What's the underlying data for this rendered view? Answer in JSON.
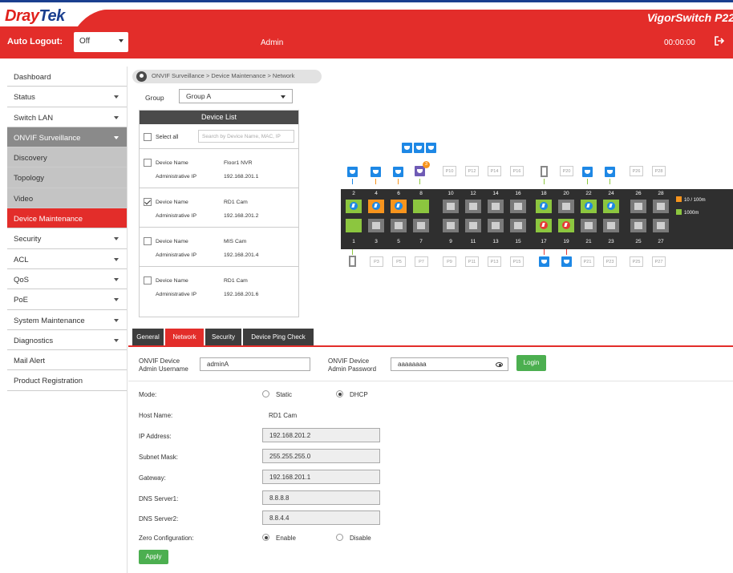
{
  "header": {
    "logo_a": "Dray",
    "logo_b": "Tek",
    "product": "VigorSwitch P22"
  },
  "toolbar": {
    "auto_logout_label": "Auto Logout:",
    "auto_logout_value": "Off",
    "user": "Admin",
    "timer": "00:00:00"
  },
  "sidebar": {
    "items": [
      {
        "label": "Dashboard"
      },
      {
        "label": "Status"
      },
      {
        "label": "Switch LAN"
      },
      {
        "label": "ONVIF Surveillance"
      },
      {
        "label": "Discovery"
      },
      {
        "label": "Topology"
      },
      {
        "label": "Video"
      },
      {
        "label": "Device Maintenance"
      },
      {
        "label": "Security"
      },
      {
        "label": "ACL"
      },
      {
        "label": "QoS"
      },
      {
        "label": "PoE"
      },
      {
        "label": "System Maintenance"
      },
      {
        "label": "Diagnostics"
      },
      {
        "label": "Mail Alert"
      },
      {
        "label": "Product Registration"
      }
    ]
  },
  "breadcrumb": "ONVIF Surveillance > Device Maintenance > Network",
  "group": {
    "label": "Group",
    "value": "Group A"
  },
  "device_list": {
    "title": "Device List",
    "select_all": "Select all",
    "search_placeholder": "Search by Device Name, MAC, IP",
    "name_label": "Device Name",
    "ip_label": "Administrative IP",
    "devices": [
      {
        "name": "Floor1 NVR",
        "ip": "192.168.201.1",
        "checked": false
      },
      {
        "name": "RD1 Cam",
        "ip": "192.168.201.2",
        "checked": true
      },
      {
        "name": "MIS Cam",
        "ip": "192.168.201.4",
        "checked": false
      },
      {
        "name": "RD1 Cam",
        "ip": "192.168.201.6",
        "checked": false
      }
    ]
  },
  "switch_panel": {
    "top_numbers": [
      "2",
      "4",
      "6",
      "8",
      "10",
      "12",
      "14",
      "16",
      "18",
      "20",
      "22",
      "24",
      "26",
      "28"
    ],
    "bottom_numbers": [
      "1",
      "3",
      "5",
      "7",
      "9",
      "11",
      "13",
      "15",
      "17",
      "19",
      "21",
      "23",
      "25",
      "27"
    ],
    "top_labels": {
      "p10": "P10",
      "p12": "P12",
      "p14": "P14",
      "p16": "P16",
      "p20": "P20",
      "p26": "P26",
      "p28": "P28"
    },
    "bottom_labels": {
      "p3": "P3",
      "p5": "P5",
      "p7": "P7",
      "p9": "P9",
      "p11": "P11",
      "p13": "P13",
      "p15": "P15",
      "p21": "P21",
      "p23": "P23",
      "p25": "P25",
      "p27": "P27"
    },
    "badge": "3",
    "legend": [
      {
        "label": "10 / 100m",
        "color": "#f7941d"
      },
      {
        "label": "1000m",
        "color": "#8cc63f"
      }
    ]
  },
  "tabs": [
    {
      "label": "General"
    },
    {
      "label": "Network"
    },
    {
      "label": "Security"
    },
    {
      "label": "Device Ping Check"
    }
  ],
  "credentials": {
    "user_label_1": "ONVIF Device",
    "user_label_2": "Admin Username",
    "username": "adminA",
    "pass_label_1": "ONVIF Device",
    "pass_label_2": "Admin Password",
    "password": "aaaaaaaa",
    "login": "Login"
  },
  "network": {
    "mode_label": "Mode:",
    "static": "Static",
    "dhcp": "DHCP",
    "mode": "DHCP",
    "host_label": "Host Name:",
    "host": "RD1 Cam",
    "ip_label": "IP Address:",
    "ip": "192.168.201.2",
    "mask_label": "Subnet Mask:",
    "mask": "255.255.255.0",
    "gw_label": "Gateway:",
    "gw": "192.168.201.1",
    "dns1_label": "DNS Server1:",
    "dns1": "8.8.8.8",
    "dns2_label": "DNS Server2:",
    "dns2": "8.8.4.4",
    "zero_label": "Zero Configuration:",
    "enable": "Enable",
    "disable": "Disable",
    "zero": "Enable",
    "apply": "Apply"
  },
  "colors": {
    "brand_red": "#e32d2a",
    "brand_blue": "#1a3f8f",
    "port_10_100": "#f7941d",
    "port_1000": "#8cc63f",
    "camera_blue": "#1e88e5",
    "button_green": "#4caf50"
  }
}
